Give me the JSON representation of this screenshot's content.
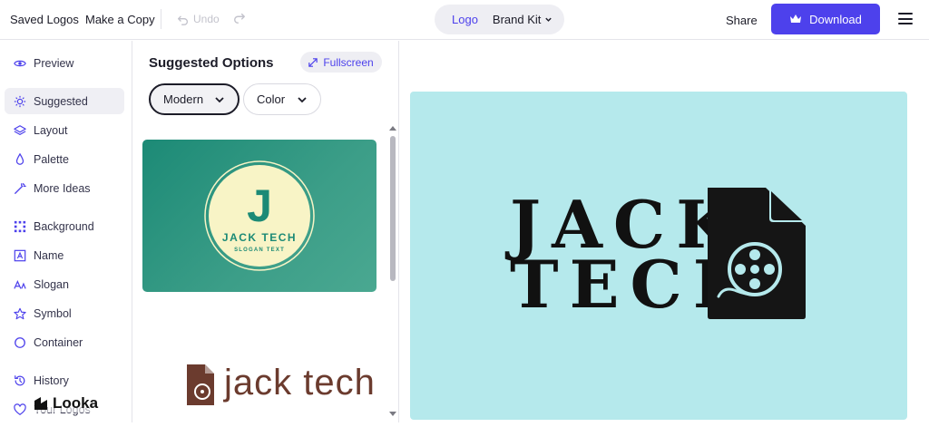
{
  "topbar": {
    "saved_logos": "Saved Logos",
    "make_copy": "Make a Copy",
    "undo": "Undo",
    "seg_logo": "Logo",
    "seg_brand_kit": "Brand Kit",
    "share": "Share",
    "download": "Download"
  },
  "sidebar": {
    "items": [
      {
        "label": "Preview",
        "icon": "eye-icon"
      },
      {
        "label": "Suggested",
        "icon": "sparkle-icon"
      },
      {
        "label": "Layout",
        "icon": "layers-icon"
      },
      {
        "label": "Palette",
        "icon": "droplet-icon"
      },
      {
        "label": "More Ideas",
        "icon": "wand-icon"
      },
      {
        "label": "Background",
        "icon": "grid-icon"
      },
      {
        "label": "Name",
        "icon": "text-box-icon"
      },
      {
        "label": "Slogan",
        "icon": "font-icon"
      },
      {
        "label": "Symbol",
        "icon": "star-icon"
      },
      {
        "label": "Container",
        "icon": "circle-icon"
      },
      {
        "label": "History",
        "icon": "history-icon"
      },
      {
        "label": "Your Logos",
        "icon": "heart-icon"
      }
    ],
    "brand": "Looka"
  },
  "panel": {
    "title": "Suggested Options",
    "fullscreen": "Fullscreen",
    "style_filter": "Modern",
    "color_filter": "Color",
    "card1": {
      "letter": "J",
      "name": "JACK TECH",
      "slogan": "SLOGAN TEXT"
    },
    "card2": {
      "name": "jack tech"
    }
  },
  "preview": {
    "line1": "JACK",
    "line2": "TECH"
  },
  "colors": {
    "accent": "#4d41ec",
    "preview_bg": "#b5e9ec",
    "card_green": "#1c8a76",
    "card_cream": "#f8f4c6",
    "card2_brown": "#6b3b2e"
  }
}
